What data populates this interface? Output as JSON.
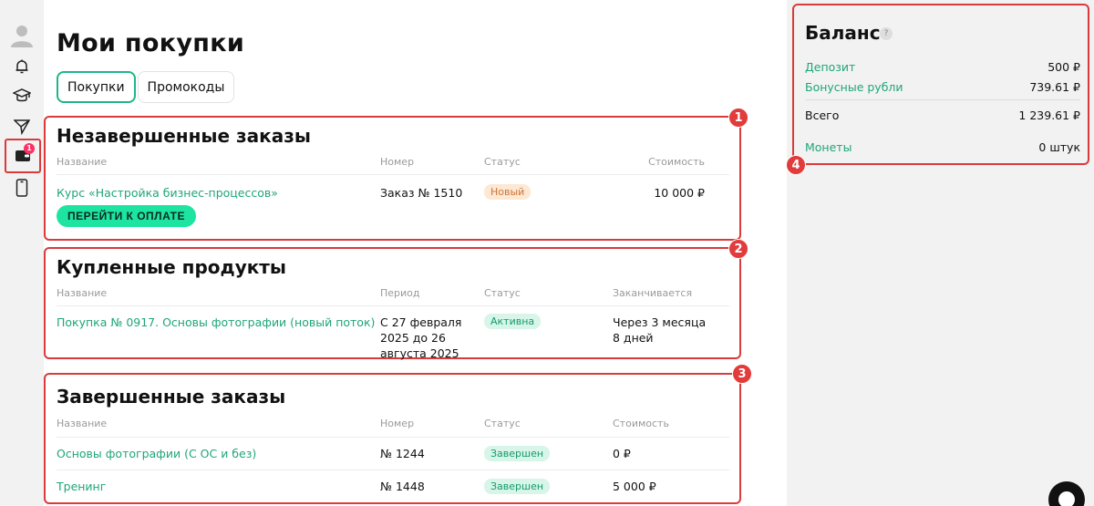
{
  "sidebar": {
    "items": [
      {
        "icon": "avatar-icon"
      },
      {
        "icon": "bell-icon"
      },
      {
        "icon": "graduation-cap-icon"
      },
      {
        "icon": "send-icon"
      },
      {
        "icon": "wallet-icon",
        "badge": "1",
        "active": true
      },
      {
        "icon": "phone-icon"
      }
    ]
  },
  "header": {
    "title": "Мои покупки"
  },
  "tabs": [
    {
      "label": "Покупки",
      "active": true
    },
    {
      "label": "Промокоды",
      "active": false
    }
  ],
  "markers": [
    "1",
    "2",
    "3",
    "4"
  ],
  "unfinished": {
    "title": "Незавершенные заказы",
    "headers": {
      "name": "Название",
      "number": "Номер",
      "status": "Статус",
      "cost": "Стоимость"
    },
    "rows": [
      {
        "name": "Курс «Настройка бизнес-процессов»",
        "number": "Заказ № 1510",
        "status": "Новый",
        "cost": "10 000 ₽"
      }
    ],
    "pay_button": "ПЕРЕЙТИ К ОПЛАТЕ"
  },
  "purchased": {
    "title": "Купленные продукты",
    "headers": {
      "name": "Название",
      "period": "Период",
      "status": "Статус",
      "ends": "Заканчивается"
    },
    "rows": [
      {
        "name": "Покупка № 0917. Основы фотографии (новый поток)",
        "period_line1": "С 27 февраля",
        "period_line2": "2025 до 26",
        "period_line3": "августа 2025",
        "status": "Активна",
        "ends_line1": "Через 3 месяца",
        "ends_line2": "8 дней"
      }
    ]
  },
  "completed": {
    "title": "Завершенные заказы",
    "headers": {
      "name": "Название",
      "number": "Номер",
      "status": "Статус",
      "cost": "Стоимость"
    },
    "rows": [
      {
        "name": "Основы фотографии (С ОС и без)",
        "number": "№ 1244",
        "status": "Завершен",
        "cost": "0 ₽"
      },
      {
        "name": "Тренинг",
        "number": "№ 1448",
        "status": "Завершен",
        "cost": "5 000 ₽"
      }
    ]
  },
  "balance": {
    "title": "Баланс",
    "help": "?",
    "deposit_label": "Депозит",
    "deposit_value": "500 ₽",
    "bonus_label": "Бонусные рубли",
    "bonus_value": "739.61 ₽",
    "total_label": "Всего",
    "total_value": "1 239.61 ₽",
    "coins_label": "Монеты",
    "coins_value": "0 штук"
  },
  "colors": {
    "accent": "#1fa57a",
    "highlight": "#d93b3b",
    "button": "#1de4a1"
  }
}
